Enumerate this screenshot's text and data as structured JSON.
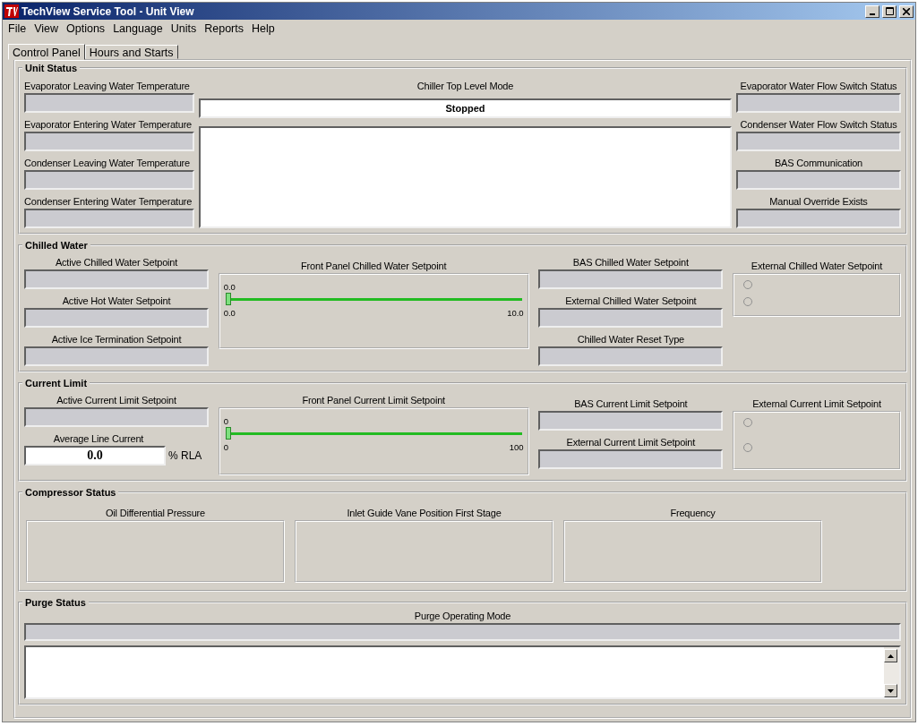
{
  "window": {
    "title": "TechView Service Tool - Unit View"
  },
  "menu": [
    "File",
    "View",
    "Options",
    "Language",
    "Units",
    "Reports",
    "Help"
  ],
  "tabs": [
    {
      "label": "Control Panel",
      "selected": true
    },
    {
      "label": "Hours and Starts",
      "selected": false
    }
  ],
  "unit_status": {
    "title": "Unit Status",
    "left_fields": [
      {
        "label": "Evaporator Leaving Water Temperature"
      },
      {
        "label": "Evaporator Entering Water Temperature"
      },
      {
        "label": "Condenser Leaving Water Temperature"
      },
      {
        "label": "Condenser Entering Water Temperature"
      }
    ],
    "mode": {
      "label": "Chiller Top Level Mode",
      "value": "Stopped"
    },
    "right_fields": [
      {
        "label": "Evaporator Water Flow Switch Status"
      },
      {
        "label": "Condenser Water Flow Switch Status"
      },
      {
        "label": "BAS Communication"
      },
      {
        "label": "Manual Override Exists"
      }
    ]
  },
  "chilled_water": {
    "title": "Chilled Water",
    "left_fields": [
      {
        "label": "Active Chilled Water Setpoint"
      },
      {
        "label": "Active Hot Water Setpoint"
      },
      {
        "label": "Active Ice Termination Setpoint"
      }
    ],
    "slider": {
      "label": "Front Panel Chilled Water Setpoint",
      "value_label": "0.0",
      "min_label": "0.0",
      "max_label": "10.0",
      "level": 0
    },
    "right_fields": [
      {
        "label": "BAS Chilled Water Setpoint"
      },
      {
        "label": "External Chilled Water Setpoint"
      },
      {
        "label": "Chilled Water Reset Type"
      }
    ],
    "radio_group": {
      "label": "External Chilled Water Setpoint",
      "options": [
        {
          "selected": false
        },
        {
          "selected": false
        }
      ]
    }
  },
  "current_limit": {
    "title": "Current Limit",
    "left_fields": [
      {
        "label": "Active Current Limit Setpoint"
      }
    ],
    "average": {
      "label": "Average Line Current",
      "value": "0.0",
      "unit": "% RLA"
    },
    "slider": {
      "label": "Front Panel Current Limit Setpoint",
      "value_label": "0",
      "min_label": "0",
      "max_label": "100",
      "level": 0
    },
    "right_fields": [
      {
        "label": "BAS Current Limit Setpoint"
      },
      {
        "label": "External Current Limit Setpoint"
      }
    ],
    "radio_group": {
      "label": "External Current Limit Setpoint",
      "options": [
        {
          "selected": false
        },
        {
          "selected": false
        }
      ]
    }
  },
  "compressor_status": {
    "title": "Compressor Status",
    "gauges": [
      {
        "label": "Oil Differential Pressure"
      },
      {
        "label": "Inlet Guide Vane Position First Stage"
      },
      {
        "label": "Frequency"
      }
    ]
  },
  "purge_status": {
    "title": "Purge Status",
    "field": {
      "label": "Purge Operating Mode"
    }
  }
}
